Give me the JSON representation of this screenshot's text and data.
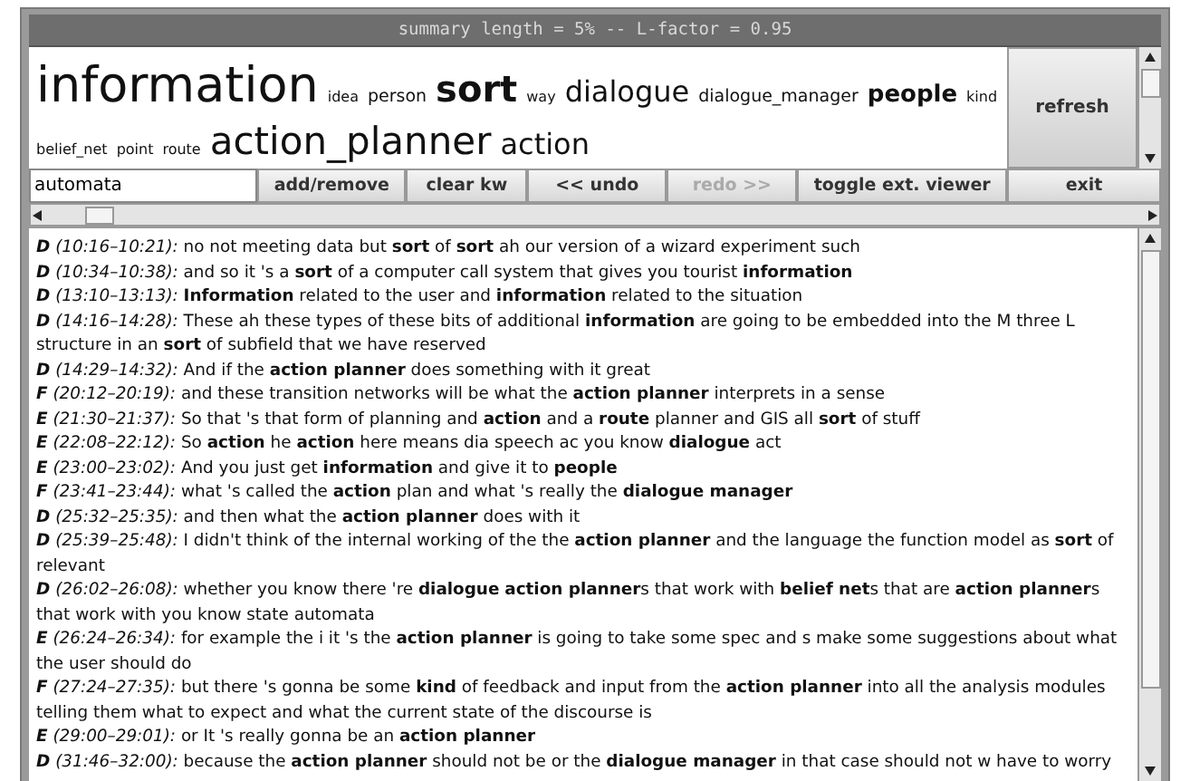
{
  "window": {
    "title": "summary length = 5% -- L-factor = 0.95"
  },
  "tag_cloud": [
    {
      "label": "information",
      "kind": "xxl"
    },
    {
      "label": "idea",
      "kind": "xs"
    },
    {
      "label": "person",
      "kind": "s"
    },
    {
      "label": "sort",
      "kind": "xl-bold"
    },
    {
      "label": "way",
      "kind": "xs"
    },
    {
      "label": "dialogue",
      "kind": "l"
    },
    {
      "label": "dialogue_manager",
      "kind": "s"
    },
    {
      "label": "people",
      "kind": "m-bold"
    },
    {
      "label": "kind",
      "kind": "xs"
    },
    {
      "label": "belief_net",
      "kind": "xs"
    },
    {
      "label": "point",
      "kind": "xs"
    },
    {
      "label": "route",
      "kind": "xs"
    },
    {
      "label": "action_planner",
      "kind": "xl"
    },
    {
      "label": "action",
      "kind": "l"
    }
  ],
  "refresh_button": "refresh",
  "toolbar": {
    "keyword_field": {
      "value": "automata"
    },
    "buttons": [
      {
        "label": "add/remove",
        "disabled": false
      },
      {
        "label": "clear kw",
        "disabled": false
      },
      {
        "label": "<< undo",
        "disabled": false
      },
      {
        "label": "redo >>",
        "disabled": true
      },
      {
        "label": "toggle ext. viewer",
        "disabled": false
      },
      {
        "label": "exit",
        "disabled": false
      }
    ]
  },
  "transcript": [
    {
      "speaker": "D",
      "time": "(10:16–10:21):",
      "text": "no not meeting data but **sort** of **sort** ah our version of a wizard experiment such"
    },
    {
      "speaker": "D",
      "time": "(10:34–10:38):",
      "text": "and so it 's a **sort** of a computer call system that gives you tourist **information**"
    },
    {
      "speaker": "D",
      "time": "(13:10–13:13):",
      "text": "**Information** related to the user and **information** related to the situation"
    },
    {
      "speaker": "D",
      "time": "(14:16–14:28):",
      "text": "These ah these types of these bits of additional **information** are going to be embedded into the M three L structure in an **sort** of subfield that we have reserved"
    },
    {
      "speaker": "D",
      "time": "(14:29–14:32):",
      "text": "And if the **action planner** does something with it great"
    },
    {
      "speaker": "F",
      "time": "(20:12–20:19):",
      "text": "and these transition networks will be what the **action planner** interprets in a sense"
    },
    {
      "speaker": "E",
      "time": "(21:30–21:37):",
      "text": "So that 's that form of planning and **action** and a **route** planner and GIS all **sort** of stuff"
    },
    {
      "speaker": "E",
      "time": "(22:08–22:12):",
      "text": "So **action** he **action** here means dia speech ac you know **dialogue** act"
    },
    {
      "speaker": "E",
      "time": "(23:00–23:02):",
      "text": "And you just get **information** and give it to **people**"
    },
    {
      "speaker": "F",
      "time": "(23:41–23:44):",
      "text": "what 's called the **action** plan and what 's really the **dialogue manager**"
    },
    {
      "speaker": "D",
      "time": "(25:32–25:35):",
      "text": "and then what the **action planner** does with it"
    },
    {
      "speaker": "D",
      "time": "(25:39–25:48):",
      "text": "I didn't think of the internal working of the the **action planner** and the language the function model as **sort** of relevant"
    },
    {
      "speaker": "D",
      "time": "(26:02–26:08):",
      "text": "whether you know there 're **dialogue** **action planner**s that work with **belief net**s that are **action planner**s that work with you know state automata"
    },
    {
      "speaker": "E",
      "time": "(26:24–26:34):",
      "text": "for example the i it 's the **action planner** is going to take some spec and s make some suggestions about what the user should do"
    },
    {
      "speaker": "F",
      "time": "(27:24–27:35):",
      "text": "but there 's gonna be some **kind** of feedback and input from the **action planner** into all the analysis modules telling them what to expect and what the current state of the discourse is"
    },
    {
      "speaker": "E",
      "time": "(29:00–29:01):",
      "text": "or It 's really gonna be an **action planner**"
    },
    {
      "speaker": "D",
      "time": "(31:46–32:00):",
      "text": "because the **action planner** should not be or the **dialogue manager** in that case should not w have to worry"
    }
  ]
}
